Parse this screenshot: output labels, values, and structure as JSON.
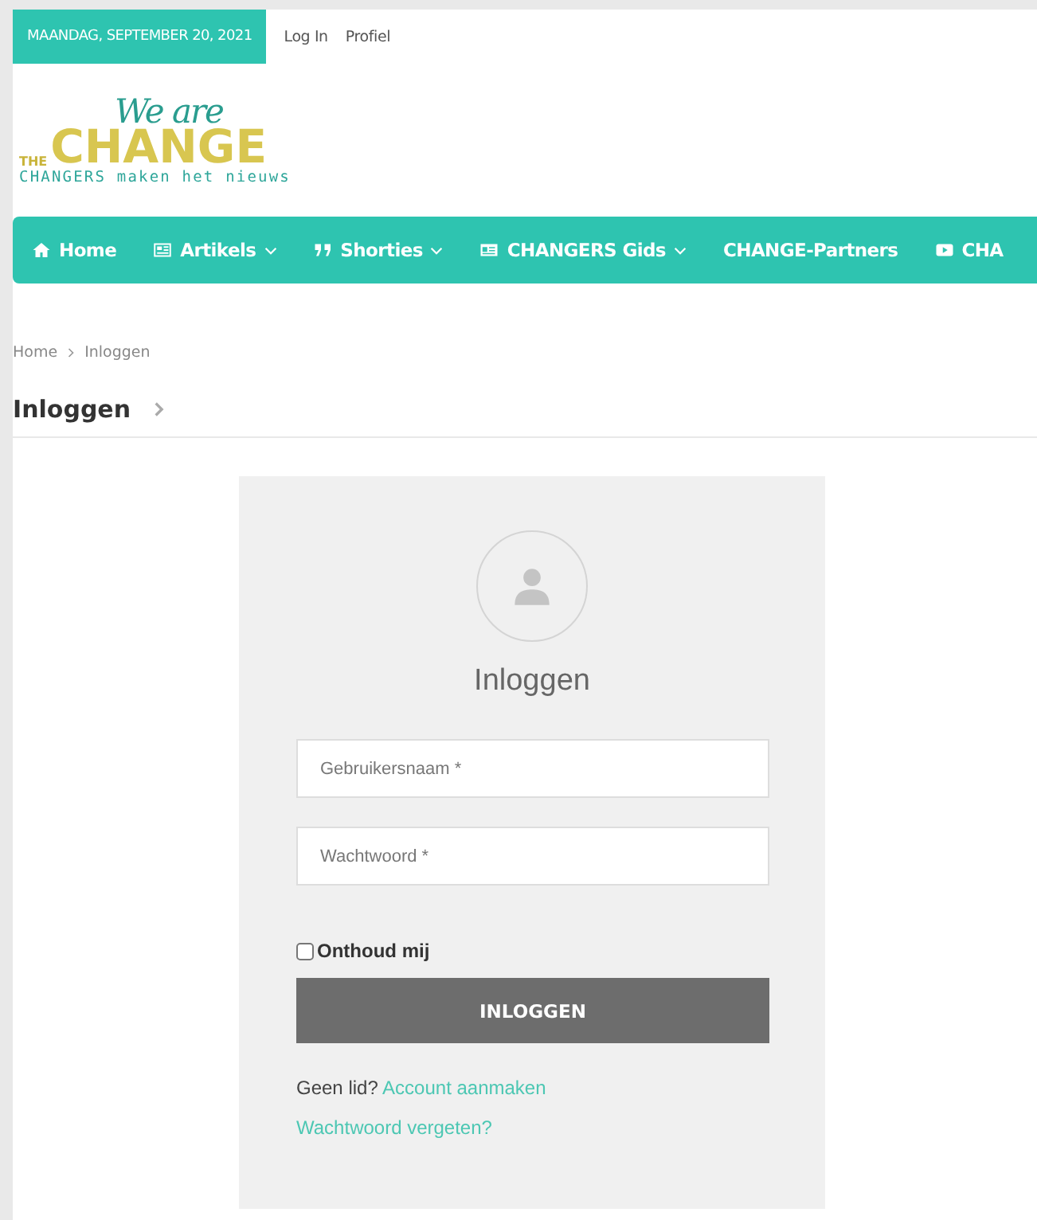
{
  "top_bar": {
    "date": "MAANDAG, SEPTEMBER 20, 2021",
    "links": [
      "Log In",
      "Profiel"
    ]
  },
  "logo": {
    "script": "We are",
    "small": "THE",
    "main": "CHANGE",
    "tagline": "CHANGERS maken het nieuws"
  },
  "nav": {
    "items": [
      {
        "label": "Home",
        "dropdown": false
      },
      {
        "label": "Artikels",
        "dropdown": true
      },
      {
        "label": "Shorties",
        "dropdown": true
      },
      {
        "label": "CHANGERS Gids",
        "dropdown": true
      },
      {
        "label": "CHANGE-Partners",
        "dropdown": false
      },
      {
        "label": "CHA",
        "dropdown": false
      }
    ]
  },
  "breadcrumb": [
    "Home",
    "Inloggen"
  ],
  "page_title": "Inloggen",
  "login": {
    "title": "Inloggen",
    "fields": [
      {
        "placeholder": "Gebruikersnaam *"
      },
      {
        "placeholder": "Wachtwoord *"
      }
    ],
    "remember": {
      "label": "Onthoud mij",
      "checked": false
    },
    "button": "INLOGGEN",
    "signup_prompt": "Geen lid?",
    "signup_link": "Account aanmaken",
    "forgot_link": "Wachtwoord vergeten?"
  }
}
